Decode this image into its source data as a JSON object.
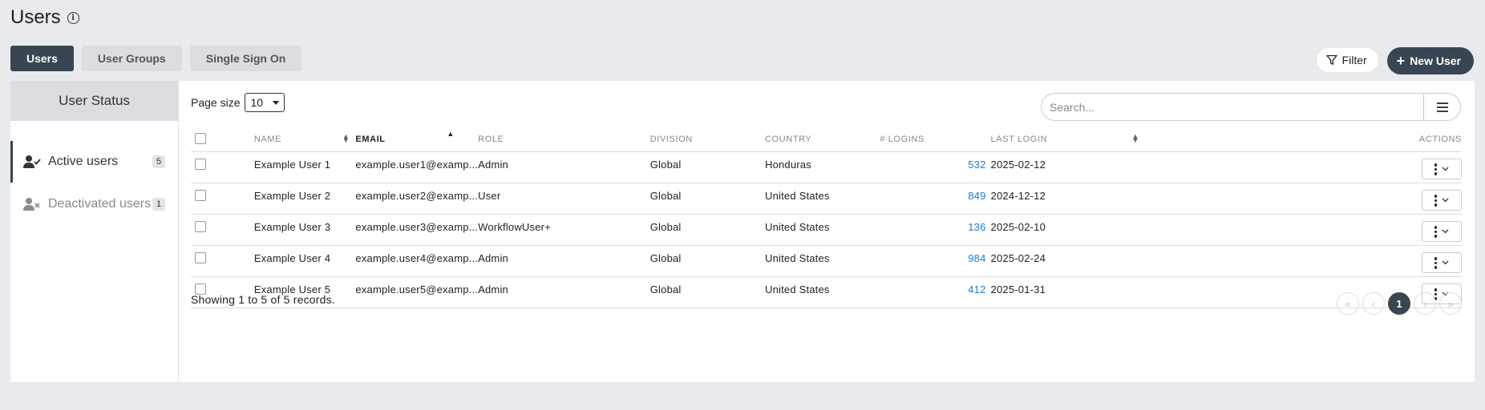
{
  "page": {
    "title": "Users"
  },
  "tabs": [
    {
      "label": "Users",
      "active": true
    },
    {
      "label": "User Groups",
      "active": false
    },
    {
      "label": "Single Sign On",
      "active": false
    }
  ],
  "actions": {
    "filter_label": "Filter",
    "new_user_label": "New User"
  },
  "sidebar": {
    "header": "User Status",
    "items": [
      {
        "label": "Active users",
        "count": "5",
        "active": true
      },
      {
        "label": "Deactivated users",
        "count": "1",
        "active": false
      }
    ]
  },
  "toolbar": {
    "page_size_label": "Page size",
    "page_size_value": "10",
    "search_placeholder": "Search..."
  },
  "table": {
    "columns": {
      "name": "NAME",
      "email": "EMAIL",
      "role": "ROLE",
      "division": "DIVISION",
      "country": "COUNTRY",
      "logins": "# LOGINS",
      "last_login": "LAST LOGIN",
      "actions": "ACTIONS"
    },
    "sort": {
      "column": "email",
      "direction": "asc"
    },
    "rows": [
      {
        "name": "Example User 1",
        "email": "example.user1@examp...",
        "role": "Admin",
        "division": "Global",
        "country": "Honduras",
        "logins": "532",
        "last_login": "2025-02-12"
      },
      {
        "name": "Example User 2",
        "email": "example.user2@examp...",
        "role": "User",
        "division": "Global",
        "country": "United States",
        "logins": "849",
        "last_login": "2024-12-12"
      },
      {
        "name": "Example User 3",
        "email": "example.user3@examp...",
        "role": "WorkflowUser+",
        "division": "Global",
        "country": "United States",
        "logins": "136",
        "last_login": "2025-02-10"
      },
      {
        "name": "Example User 4",
        "email": "example.user4@examp...",
        "role": "Admin",
        "division": "Global",
        "country": "United States",
        "logins": "984",
        "last_login": "2025-02-24"
      },
      {
        "name": "Example User 5",
        "email": "example.user5@examp...",
        "role": "Admin",
        "division": "Global",
        "country": "United States",
        "logins": "412",
        "last_login": "2025-01-31"
      }
    ]
  },
  "footer": {
    "showing_text": "Showing 1 to 5 of 5 records."
  },
  "pagination": {
    "current_page": "1"
  },
  "colors": {
    "primary_dark": "#394552",
    "link_blue": "#1a7dd0",
    "page_bg": "#e9eaed"
  }
}
